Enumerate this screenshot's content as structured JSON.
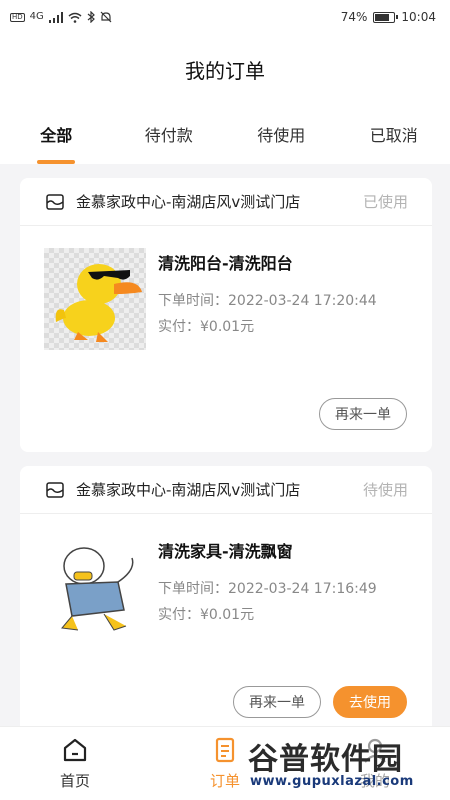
{
  "status_bar": {
    "hd": "HD",
    "network": "4G",
    "battery_percent": "74%",
    "battery_level": 0.74,
    "time": "10:04"
  },
  "header": {
    "title": "我的订单"
  },
  "tabs": [
    {
      "label": "全部",
      "active": true
    },
    {
      "label": "待付款",
      "active": false
    },
    {
      "label": "待使用",
      "active": false
    },
    {
      "label": "已取消",
      "active": false
    }
  ],
  "orders": [
    {
      "store": "金慕家政中心-南湖店风v测试门店",
      "status": "已使用",
      "product": "清洗阳台-清洗阳台",
      "order_time": "下单时间：2022-03-24 17:20:44",
      "paid": "实付：¥0.01元",
      "reorder_label": "再来一单"
    },
    {
      "store": "金慕家政中心-南湖店风v测试门店",
      "status": "待使用",
      "product": "清洗家具-清洗飘窗",
      "order_time": "下单时间：2022-03-24 17:16:49",
      "paid": "实付：¥0.01元",
      "reorder_label": "再来一单",
      "use_label": "去使用"
    }
  ],
  "bottom_nav": [
    {
      "label": "首页",
      "icon": "home-icon"
    },
    {
      "label": "订单",
      "icon": "order-icon",
      "active": true
    },
    {
      "label": "我的",
      "icon": "user-icon"
    }
  ],
  "watermark": {
    "title": "谷普软件园",
    "url": "www.gupuxlazal.com"
  },
  "colors": {
    "accent": "#f5922e"
  }
}
